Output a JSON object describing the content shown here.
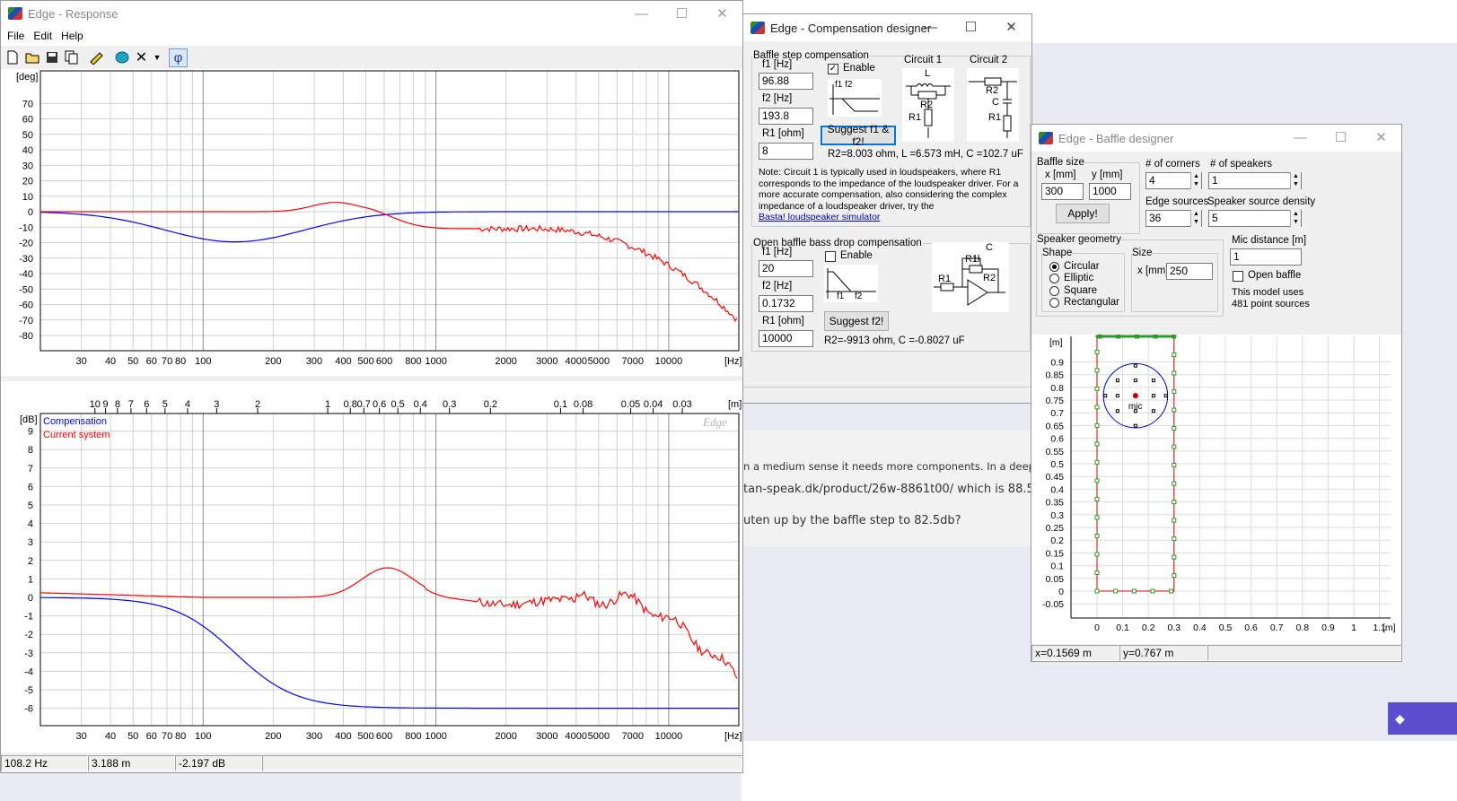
{
  "response_window": {
    "title": "Edge - Response",
    "menu": [
      "File",
      "Edit",
      "Help"
    ],
    "phi_symbol": "φ",
    "upper_plot": {
      "y_unit": "[deg]",
      "y_ticks": [
        "70",
        "60",
        "50",
        "40",
        "30",
        "20",
        "10",
        "0",
        "-10",
        "-20",
        "-30",
        "-40",
        "-50",
        "-60",
        "-70",
        "-80"
      ],
      "x_ticks": [
        "30",
        "40",
        "50",
        "60",
        "70",
        "80",
        "100",
        "200",
        "300",
        "400",
        "500",
        "600",
        "800",
        "1000",
        "2000",
        "3000",
        "4000",
        "5000",
        "7000",
        "10000"
      ],
      "x_unit": "[Hz]"
    },
    "lower_plot": {
      "y_unit": "[dB]",
      "y_ticks": [
        "9",
        "8",
        "7",
        "6",
        "5",
        "4",
        "3",
        "2",
        "1",
        "0",
        "-1",
        "-2",
        "-3",
        "-4",
        "-5",
        "-6"
      ],
      "x_ticks": [
        "30",
        "40",
        "50",
        "60",
        "70",
        "80",
        "100",
        "200",
        "300",
        "400",
        "500",
        "600",
        "800",
        "1000",
        "2000",
        "3000",
        "4000",
        "5000",
        "7000",
        "10000"
      ],
      "x_unit": "[Hz]",
      "top_ticks": [
        "10",
        "9",
        "8",
        "7",
        "6",
        "5",
        "4",
        "3",
        "2",
        "1",
        "0.8",
        "0.7",
        "0.6",
        "0.5",
        "0.4",
        "0.3",
        "0.2",
        "0.1",
        "0.08",
        "0.05",
        "0.04",
        "0.03"
      ],
      "top_unit": "[m]",
      "watermark": "Edge",
      "legend": [
        {
          "name": "Compensation",
          "color": "#0000ff"
        },
        {
          "name": "Current system",
          "color": "#ff0000"
        }
      ]
    },
    "status": [
      "108.2 Hz",
      "3.188 m",
      "-2.197 dB"
    ]
  },
  "compensation_window": {
    "title": "Edge - Compensation designer",
    "baffle_step": {
      "legend": "Baffle step compensation",
      "f1_label": "f1 [Hz]",
      "f1_value": "96.88",
      "f2_label": "f2 [Hz]",
      "f2_value": "193.8",
      "r1_label": "R1 [ohm]",
      "r1_value": "8",
      "enable_label": "Enable",
      "curve_label": "f1 f2",
      "circuit1_label": "Circuit 1",
      "circuit2_label": "Circuit 2",
      "suggest_button": "Suggest f1 & f2!",
      "result": "R2=8.003 ohm, L =6.573 mH, C =102.7 uF",
      "note": "Note: Circuit 1 is typically used in loudspeakers, where R1 corresponds to the impedance of the loudspeaker driver. For a more accurate compensation, also considering the complex impedance of a loudspeaker driver, try the",
      "link": "Basta! loudspeaker simulator"
    },
    "open_baffle": {
      "legend": "Open baffle bass drop compensation",
      "f1_label": "f1 [Hz]",
      "f1_value": "20",
      "f2_label": "f2 [Hz]",
      "f2_value": "0.1732",
      "r1_label": "R1 [ohm]",
      "r1_value": "10000",
      "enable_label": "Enable",
      "suggest_button": "Suggest f2!",
      "result": "R2=-9913 ohm, C =-0.8027 uF"
    },
    "components": {
      "L": "L",
      "R1": "R1",
      "R2": "R2",
      "C": "C"
    }
  },
  "baffle_window": {
    "title": "Edge - Baffle designer",
    "baffle_size_legend": "Baffle size",
    "x_label": "x [mm]",
    "x_value": "300",
    "y_label": "y [mm]",
    "y_value": "1000",
    "apply_button": "Apply!",
    "corners_label": "# of corners",
    "corners_value": "4",
    "speakers_label": "# of speakers",
    "speakers_value": "1",
    "edge_sources_label": "Edge sources",
    "edge_sources_value": "36",
    "density_label": "Speaker source density",
    "density_value": "5",
    "geometry_legend": "Speaker geometry",
    "shape_legend": "Shape",
    "shapes": [
      "Circular",
      "Elliptic",
      "Square",
      "Rectangular"
    ],
    "size_legend": "Size",
    "size_label": "x [mm]",
    "size_value": "250",
    "mic_label": "Mic distance [m]",
    "mic_value": "1",
    "open_baffle_label": "Open baffle",
    "model_info": "This model uses 481 point sources",
    "plot": {
      "y_unit": "[m]",
      "y_ticks": [
        "0.9",
        "0.85",
        "0.8",
        "0.75",
        "0.7",
        "0.65",
        "0.6",
        "0.55",
        "0.5",
        "0.45",
        "0.4",
        "0.35",
        "0.3",
        "0.25",
        "0.2",
        "0.15",
        "0.1",
        "0.05",
        "0",
        "-0.05"
      ],
      "x_ticks": [
        "0",
        "0.1",
        "0.2",
        "0.3",
        "0.4",
        "0.5",
        "0.6",
        "0.7",
        "0.8",
        "0.9",
        "1",
        "1.1"
      ],
      "x_unit": "[m]",
      "mic_label": "mic"
    },
    "status": [
      "x=0.1569 m",
      "y=0.767 m"
    ]
  },
  "background": {
    "lines": [
      "n a medium sense it needs more components. In a deeper s",
      "tan-speak.dk/product/26w-8861t00/ which is 88.5",
      "uten up by the baffle step to 82.5db?"
    ],
    "fab_icon": "◆"
  }
}
